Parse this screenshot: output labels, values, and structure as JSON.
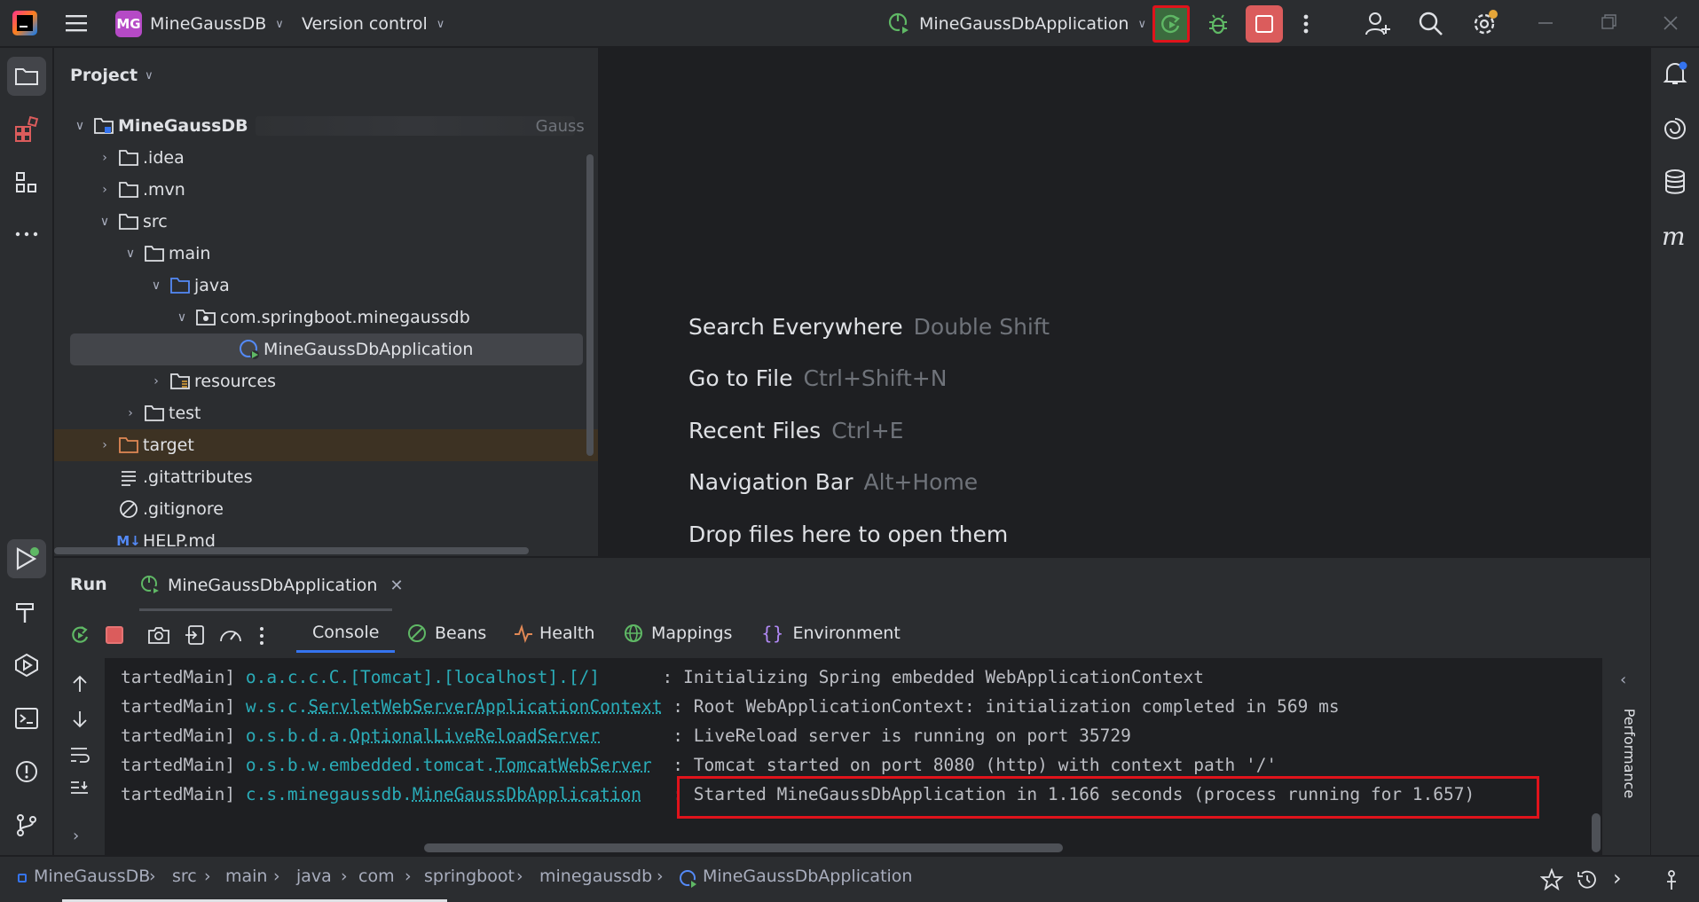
{
  "titlebar": {
    "project_badge": "MG",
    "project_name": "MineGaussDB",
    "vcs_label": "Version control",
    "run_config": "MineGaussDbApplication"
  },
  "project_panel": {
    "title": "Project",
    "items": [
      {
        "label": "MineGaussDB",
        "suffix": "Gauss",
        "bold": true
      },
      {
        "label": ".idea"
      },
      {
        "label": ".mvn"
      },
      {
        "label": "src"
      },
      {
        "label": "main"
      },
      {
        "label": "java"
      },
      {
        "label": "com.springboot.minegaussdb"
      },
      {
        "label": "MineGaussDbApplication",
        "selected": true
      },
      {
        "label": "resources"
      },
      {
        "label": "test"
      },
      {
        "label": "target"
      },
      {
        "label": ".gitattributes"
      },
      {
        "label": ".gitignore"
      },
      {
        "label": "HELP.md"
      }
    ]
  },
  "editor": {
    "hints": [
      {
        "action": "Search Everywhere",
        "key": "Double Shift"
      },
      {
        "action": "Go to File",
        "key": "Ctrl+Shift+N"
      },
      {
        "action": "Recent Files",
        "key": "Ctrl+E"
      },
      {
        "action": "Navigation Bar",
        "key": "Alt+Home"
      },
      {
        "action": "Drop files here to open them",
        "key": ""
      }
    ]
  },
  "run_window": {
    "title": "Run",
    "tab_label": "MineGaussDbApplication",
    "tabs": {
      "console": "Console",
      "beans": "Beans",
      "health": "Health",
      "mappings": "Mappings",
      "environment": "Environment"
    },
    "side_label": "Performance",
    "console_lines": [
      {
        "thread": "tartedMain]",
        "pkg": "o.a.c.c.C.[Tomcat].[localhost].[/]",
        "cls": "",
        "pad": "      ",
        "msg": ": Initializing Spring embedded WebApplicationContext"
      },
      {
        "thread": "tartedMain]",
        "pkg": "w.s.c.",
        "cls": "ServletWebServerApplicationContext",
        "pad": " ",
        "msg": ": Root WebApplicationContext: initialization completed in 569 ms"
      },
      {
        "thread": "tartedMain]",
        "pkg": "o.s.b.d.a.",
        "cls": "OptionalLiveReloadServer",
        "pad": "       ",
        "msg": ": LiveReload server is running on port 35729"
      },
      {
        "thread": "tartedMain]",
        "pkg": "o.s.b.w.embedded.tomcat.",
        "cls": "TomcatWebServer",
        "pad": "  ",
        "msg": ": Tomcat started on port 8080 (http) with context path '/'"
      },
      {
        "thread": "tartedMain]",
        "pkg": "c.s.minegaussdb.",
        "cls": "MineGaussDbApplication",
        "pad": "   ",
        "msg": ": Started MineGaussDbApplication in 1.166 seconds (process running for 1.657)"
      }
    ]
  },
  "statusbar": {
    "crumbs": [
      "MineGaussDB",
      "src",
      "main",
      "java",
      "com",
      "springboot",
      "minegaussdb",
      "MineGaussDbApplication"
    ]
  },
  "colors": {
    "accent_green": "#5fb865",
    "stop_red": "#db5c5c",
    "highlight_red": "#e0131b",
    "selection": "#43454a",
    "target_bg": "#3d3223"
  }
}
